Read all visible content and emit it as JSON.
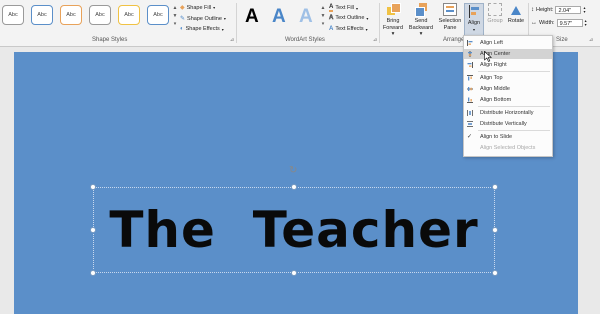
{
  "ribbon": {
    "shape_styles": {
      "label": "Shape Styles",
      "thumbnails": [
        "Abc",
        "Abc",
        "Abc",
        "Abc",
        "Abc",
        "Abc"
      ],
      "thumb_colors": [
        "#9a9a9a",
        "#5b8fc9",
        "#e8a25a",
        "#9a9a9a",
        "#f0c244",
        "#5b8fc9"
      ],
      "fill": "Shape Fill",
      "outline": "Shape Outline",
      "effects": "Shape Effects"
    },
    "wordart": {
      "label": "WordArt Styles",
      "letters": [
        "A",
        "A",
        "A"
      ],
      "letter_colors": [
        "#1a1a1a",
        "#4a86c8",
        "#6fa0d8"
      ],
      "text_fill": "Text Fill",
      "text_outline": "Text Outline",
      "text_effects": "Text Effects"
    },
    "arrange": {
      "label": "Arrange",
      "bring_forward": [
        "Bring",
        "Forward"
      ],
      "send_backward": [
        "Send",
        "Backward"
      ],
      "selection_pane": [
        "Selection",
        "Pane"
      ],
      "align": "Align",
      "group": "Group",
      "rotate": "Rotate"
    },
    "size": {
      "label": "Size",
      "height_label": "Height:",
      "height_value": "2.04\"",
      "width_label": "Width:",
      "width_value": "9.57\""
    }
  },
  "align_menu": {
    "items": [
      {
        "label": "Align Left",
        "state": "normal"
      },
      {
        "label": "Align Center",
        "state": "hover"
      },
      {
        "label": "Align Right",
        "state": "normal"
      },
      {
        "label": "Align Top",
        "state": "normal"
      },
      {
        "label": "Align Middle",
        "state": "normal"
      },
      {
        "label": "Align Bottom",
        "state": "normal"
      },
      {
        "label": "Distribute Horizontally",
        "state": "normal"
      },
      {
        "label": "Distribute Vertically",
        "state": "normal"
      },
      {
        "label": "Align to Slide",
        "state": "checked"
      },
      {
        "label": "Align Selected Objects",
        "state": "disabled"
      }
    ]
  },
  "slide": {
    "text": "The  Teacher",
    "background": "#5b8fc9"
  },
  "colors": {
    "ribbon_bg": "#f3f3f3",
    "menu_highlight": "#d3d3d3",
    "accent_orange": "#e8a25a"
  }
}
